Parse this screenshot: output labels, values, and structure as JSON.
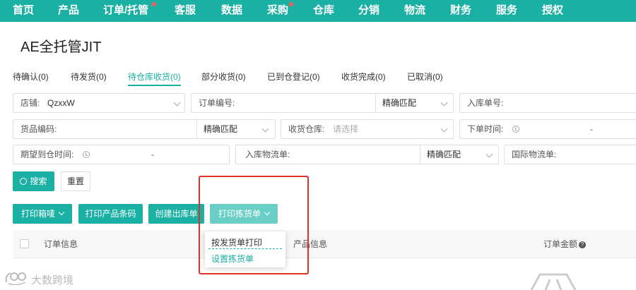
{
  "nav": {
    "items": [
      {
        "label": "首页",
        "dot": false
      },
      {
        "label": "产品",
        "dot": false
      },
      {
        "label": "订单/托管",
        "dot": true
      },
      {
        "label": "客服",
        "dot": false
      },
      {
        "label": "数据",
        "dot": false
      },
      {
        "label": "采购",
        "dot": true
      },
      {
        "label": "仓库",
        "dot": false
      },
      {
        "label": "分销",
        "dot": false
      },
      {
        "label": "物流",
        "dot": false
      },
      {
        "label": "财务",
        "dot": false
      },
      {
        "label": "服务",
        "dot": false
      },
      {
        "label": "授权",
        "dot": false
      }
    ]
  },
  "page": {
    "title": "AE全托管JIT"
  },
  "tabs": [
    {
      "label": "待确认(0)",
      "active": false
    },
    {
      "label": "待发货(0)",
      "active": false
    },
    {
      "label": "待仓库收货(0)",
      "active": true
    },
    {
      "label": "部分收货(0)",
      "active": false
    },
    {
      "label": "已到仓登记(0)",
      "active": false
    },
    {
      "label": "收货完成(0)",
      "active": false
    },
    {
      "label": "已取消(0)",
      "active": false
    }
  ],
  "filters": {
    "shop": {
      "label": "店铺:",
      "value": "QzxxW"
    },
    "order_no": {
      "label": "订单编号:",
      "match": "精确匹配"
    },
    "inbound_no": {
      "label": "入库单号:"
    },
    "sku": {
      "label": "货品编码:",
      "match": "精确匹配"
    },
    "warehouse": {
      "label": "收货仓库:",
      "placeholder": "请选择"
    },
    "order_time": {
      "label": "下单时间:",
      "sep": "-"
    },
    "expected_time": {
      "label": "期望到仓时间:",
      "sep": "-"
    },
    "inbound_logistics": {
      "label": "入库物流单:",
      "match": "精确匹配"
    },
    "intl_logistics": {
      "label": "国际物流单:"
    }
  },
  "actions": {
    "search": "搜索",
    "reset": "重置",
    "print_label": "打印箱唛",
    "print_barcode": "打印产品条码",
    "create_outbound": "创建出库单",
    "print_picking": "打印拣货单"
  },
  "dropdown": {
    "items": [
      "按发货单打印",
      "设置拣货单"
    ]
  },
  "table": {
    "headers": {
      "order_info": "订单信息",
      "product_info": "产品信息",
      "order_amount": "订单金额"
    }
  },
  "watermark": {
    "text": "大数跨境"
  },
  "colors": {
    "accent": "#1ab0a4",
    "highlight": "#e0302a",
    "badge_dot": "#ff5a5a"
  }
}
